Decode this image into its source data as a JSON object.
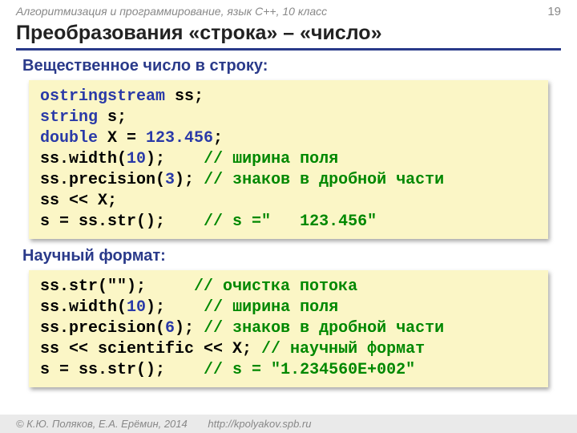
{
  "header": {
    "label": "Алгоритмизация и программирование, язык C++, 10 класс",
    "page": "19"
  },
  "title": "Преобразования «строка» – «число»",
  "section1": {
    "heading": "Вещественное число в строку:",
    "code": {
      "l1_kw": "ostringstream",
      "l1_rest": " ss;",
      "l2_kw": "string",
      "l2_rest": " s;",
      "l3_kw": "double",
      "l3_mid": " X = ",
      "l3_num": "123.456",
      "l3_end": ";",
      "l4_a": "ss.width(",
      "l4_num": "10",
      "l4_b": ");    ",
      "l4_cm": "// ширина поля",
      "l5_a": "ss.precision(",
      "l5_num": "3",
      "l5_b": "); ",
      "l5_cm": "// знаков в дробной части",
      "l6": "ss << X;",
      "l7_a": "s = ss.str();    ",
      "l7_cm": "// s =\"   123.456\""
    }
  },
  "section2": {
    "heading": "Научный формат:",
    "code": {
      "l1_a": "ss.str(\"\");     ",
      "l1_cm": "// очистка потока",
      "l2_a": "ss.width(",
      "l2_num": "10",
      "l2_b": ");    ",
      "l2_cm": "// ширина поля",
      "l3_a": "ss.precision(",
      "l3_num": "6",
      "l3_b": "); ",
      "l3_cm": "// знаков в дробной части",
      "l4_a": "ss << scientific << X; ",
      "l4_cm": "// научный формат",
      "l5_a": "s = ss.str();    ",
      "l5_cm": "// s = \"1.234560E+002\""
    }
  },
  "footer": {
    "copyright": "© К.Ю. Поляков, Е.А. Ерёмин, 2014",
    "url": "http://kpolyakov.spb.ru"
  }
}
